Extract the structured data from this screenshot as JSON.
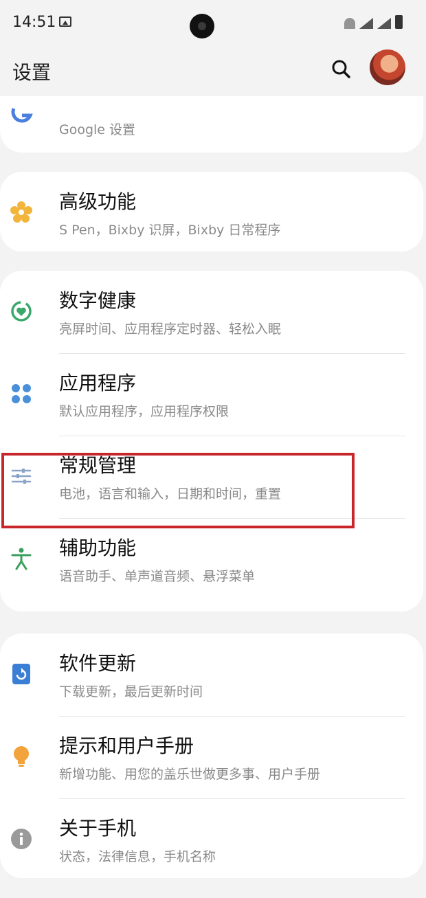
{
  "status_bar": {
    "time": "14:51"
  },
  "app_bar": {
    "title": "设置"
  },
  "partial_item": {
    "subtitle": "Google 设置"
  },
  "groups": [
    {
      "items": [
        {
          "title": "高级功能",
          "subtitle": "S Pen，Bixby 识屏，Bixby 日常程序",
          "icon": "gear-flower-icon",
          "color": "#f2b53b"
        }
      ]
    },
    {
      "items": [
        {
          "title": "数字健康",
          "subtitle": "亮屏时间、应用程序定时器、轻松入眠",
          "icon": "digital-wellbeing-icon",
          "color": "#3aa86b"
        },
        {
          "title": "应用程序",
          "subtitle": "默认应用程序，应用程序权限",
          "icon": "apps-icon",
          "color": "#4a90d9"
        },
        {
          "title": "常规管理",
          "subtitle": "电池，语言和输入，日期和时间，重置",
          "icon": "sliders-icon",
          "color": "#8aa4c8"
        },
        {
          "title": "辅助功能",
          "subtitle": "语音助手、单声道音频、悬浮菜单",
          "icon": "accessibility-icon",
          "color": "#3a9e5c"
        }
      ]
    },
    {
      "items": [
        {
          "title": "软件更新",
          "subtitle": "下载更新，最后更新时间",
          "icon": "software-update-icon",
          "color": "#3a7fd5"
        },
        {
          "title": "提示和用户手册",
          "subtitle": "新增功能、用您的盖乐世做更多事、用户手册",
          "icon": "lightbulb-icon",
          "color": "#f2a33b"
        },
        {
          "title": "关于手机",
          "subtitle": "状态，法律信息，手机名称",
          "icon": "info-icon",
          "color": "#9a9a9a"
        }
      ]
    }
  ]
}
